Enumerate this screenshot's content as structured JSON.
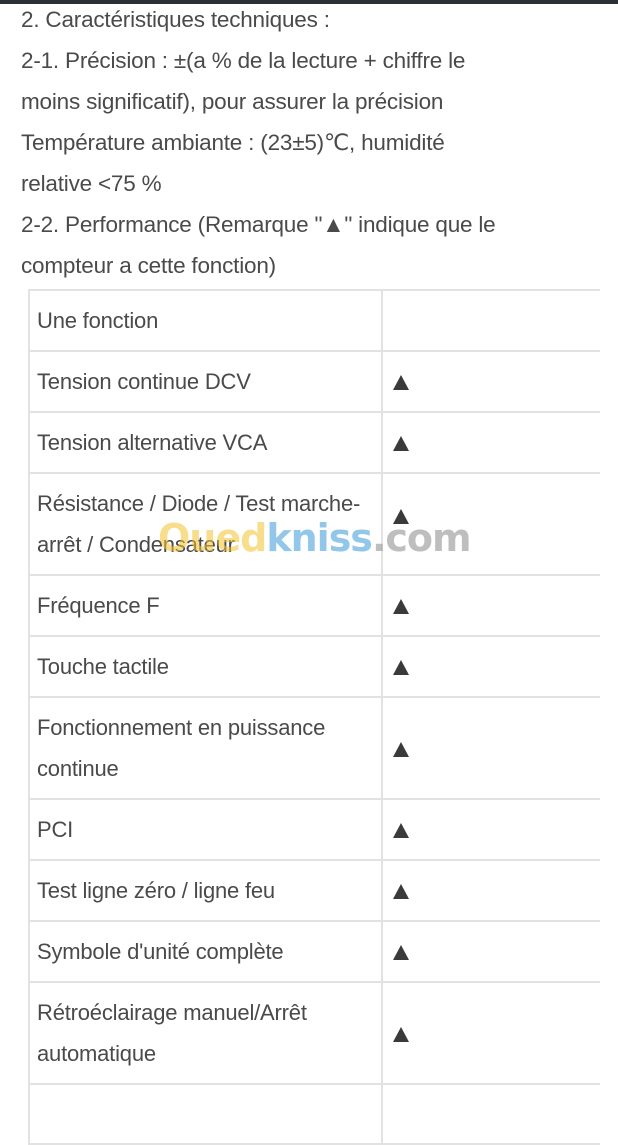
{
  "intro": {
    "heading": "2. Caractéristiques techniques :",
    "precision_line1": "2-1. Précision : ±(a % de la lecture + chiffre le",
    "precision_line2": "moins significatif), pour assurer la précision",
    "conditions_line1": "Température ambiante : (23±5)℃, humidité",
    "conditions_line2": "relative <75 %",
    "performance_line1": "2-2. Performance (Remarque \"▲\" indique que le",
    "performance_line2": "compteur a cette fonction)"
  },
  "table": {
    "header": {
      "function": "Une fonction",
      "mark": ""
    },
    "rows": [
      {
        "function": "Tension continue DCV",
        "mark": "▲"
      },
      {
        "function": "Tension alternative VCA",
        "mark": "▲"
      },
      {
        "function": "Résistance / Diode / Test marche-arrêt / Condensateur",
        "mark": "▲"
      },
      {
        "function": "Fréquence F",
        "mark": "▲"
      },
      {
        "function": "Touche tactile",
        "mark": "▲"
      },
      {
        "function": "Fonctionnement en puissance continue",
        "mark": "▲"
      },
      {
        "function": "PCI",
        "mark": "▲"
      },
      {
        "function": "Test ligne zéro / ligne feu",
        "mark": "▲"
      },
      {
        "function": "Symbole d'unité complète",
        "mark": "▲"
      },
      {
        "function": "Rétroéclairage manuel/Arrêt automatique",
        "mark": "▲"
      }
    ]
  },
  "watermark": {
    "part1": "Oued",
    "part2": "kniss",
    "part3": ".com"
  },
  "colors": {
    "text": "#4a4a4a",
    "border": "#e2e2e2",
    "watermark_yellow": "#f2c230",
    "watermark_blue": "#3a9ad9",
    "watermark_gray": "#8a8a8a"
  }
}
